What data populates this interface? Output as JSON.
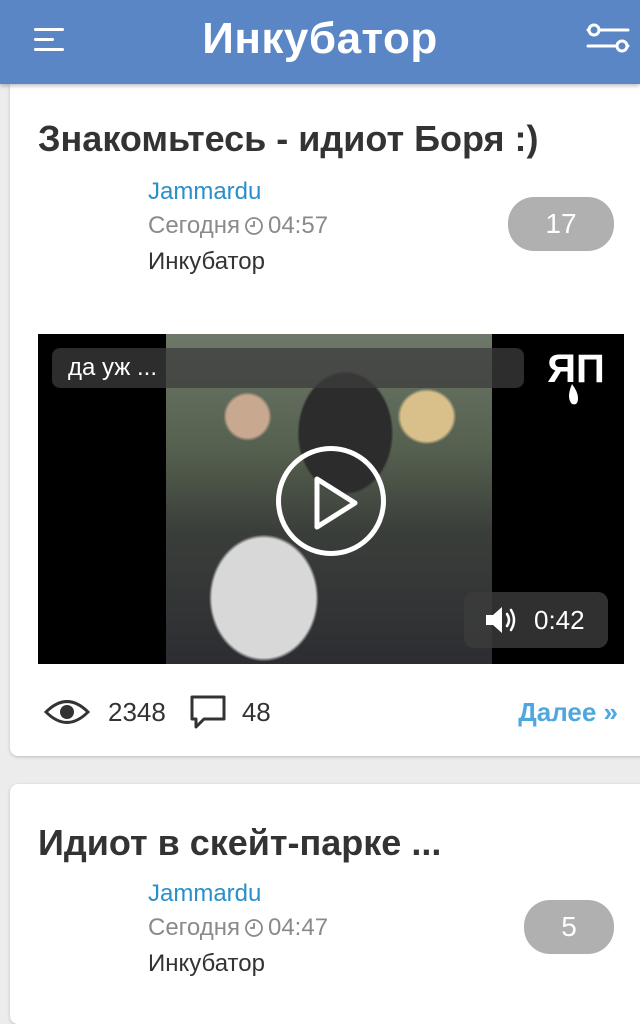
{
  "header": {
    "title": "Инкубатор",
    "menu_icon": "hamburger-menu-icon",
    "filter_icon": "filter-sliders-icon",
    "bg_color": "#5b86c5"
  },
  "posts": [
    {
      "title": "Знакомьтесь - идиот Боря :)",
      "author": "Jammardu",
      "date": "Сегодня",
      "time": "04:57",
      "category": "Инкубатор",
      "rating": "17",
      "video": {
        "caption": "да уж ...",
        "logo_text": "ЯП",
        "duration": "0:42"
      },
      "views": "2348",
      "comments": "48",
      "more_label": "Далее »"
    },
    {
      "title": "Идиот в скейт-парке ...",
      "author": "Jammardu",
      "date": "Сегодня",
      "time": "04:47",
      "category": "Инкубатор",
      "rating": "5"
    }
  ],
  "colors": {
    "author_link": "#2a8fc8",
    "more_link": "#4fa7df",
    "badge_bg": "#b0b0b0"
  }
}
